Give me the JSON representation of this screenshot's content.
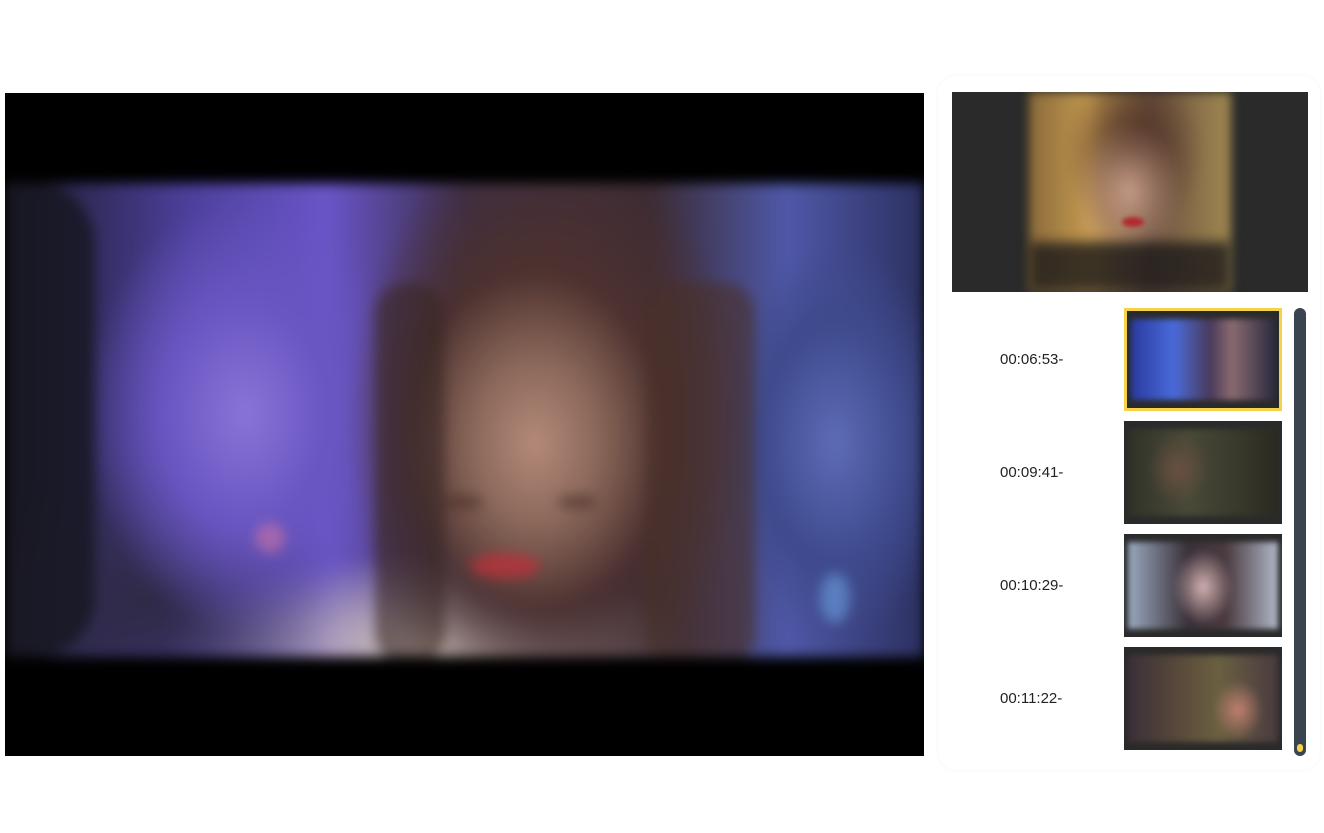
{
  "player": {
    "state": "paused"
  },
  "playlist": {
    "items": [
      {
        "time": "00:06:53-",
        "active": true
      },
      {
        "time": "00:09:41-",
        "active": false
      },
      {
        "time": "00:10:29-",
        "active": false
      },
      {
        "time": "00:11:22-",
        "active": false
      }
    ]
  },
  "colors": {
    "accent": "#f6d248",
    "scrollbar": "#3a4350"
  }
}
